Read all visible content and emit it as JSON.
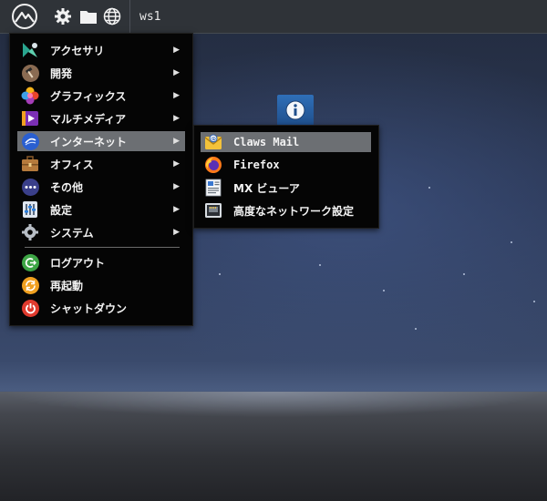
{
  "panel": {
    "workspace": "ws1",
    "icons": [
      "mx-logo-icon",
      "gear-icon",
      "folder-icon",
      "globe-icon"
    ]
  },
  "main_menu": {
    "items": [
      {
        "label": "アクセサリ",
        "icon": "accessories-icon",
        "has_submenu": true
      },
      {
        "label": "開発",
        "icon": "hammer-icon",
        "has_submenu": true
      },
      {
        "label": "グラフィックス",
        "icon": "graphics-icon",
        "has_submenu": true
      },
      {
        "label": "マルチメディア",
        "icon": "multimedia-icon",
        "has_submenu": true
      },
      {
        "label": "インターネット",
        "icon": "internet-icon",
        "has_submenu": true,
        "active": true
      },
      {
        "label": "オフィス",
        "icon": "briefcase-icon",
        "has_submenu": true
      },
      {
        "label": "その他",
        "icon": "more-icon",
        "has_submenu": true
      },
      {
        "label": "設定",
        "icon": "settings-icon",
        "has_submenu": true
      },
      {
        "label": "システム",
        "icon": "system-icon",
        "has_submenu": true
      }
    ],
    "session": [
      {
        "label": "ログアウト",
        "icon": "logout-icon"
      },
      {
        "label": "再起動",
        "icon": "reboot-icon"
      },
      {
        "label": "シャットダウン",
        "icon": "power-icon"
      }
    ],
    "arrow": "▶"
  },
  "sub_menu": {
    "items": [
      {
        "label": "Claws Mail",
        "icon": "mail-icon",
        "active": true
      },
      {
        "label": "Firefox",
        "icon": "firefox-icon"
      },
      {
        "label": "MX ビューア",
        "icon": "viewer-icon"
      },
      {
        "label": "高度なネットワーク設定",
        "icon": "network-icon"
      }
    ]
  },
  "colors": {
    "panel": "#2f3338",
    "menu_bg": "#050505",
    "highlight": "#6c6f73"
  }
}
